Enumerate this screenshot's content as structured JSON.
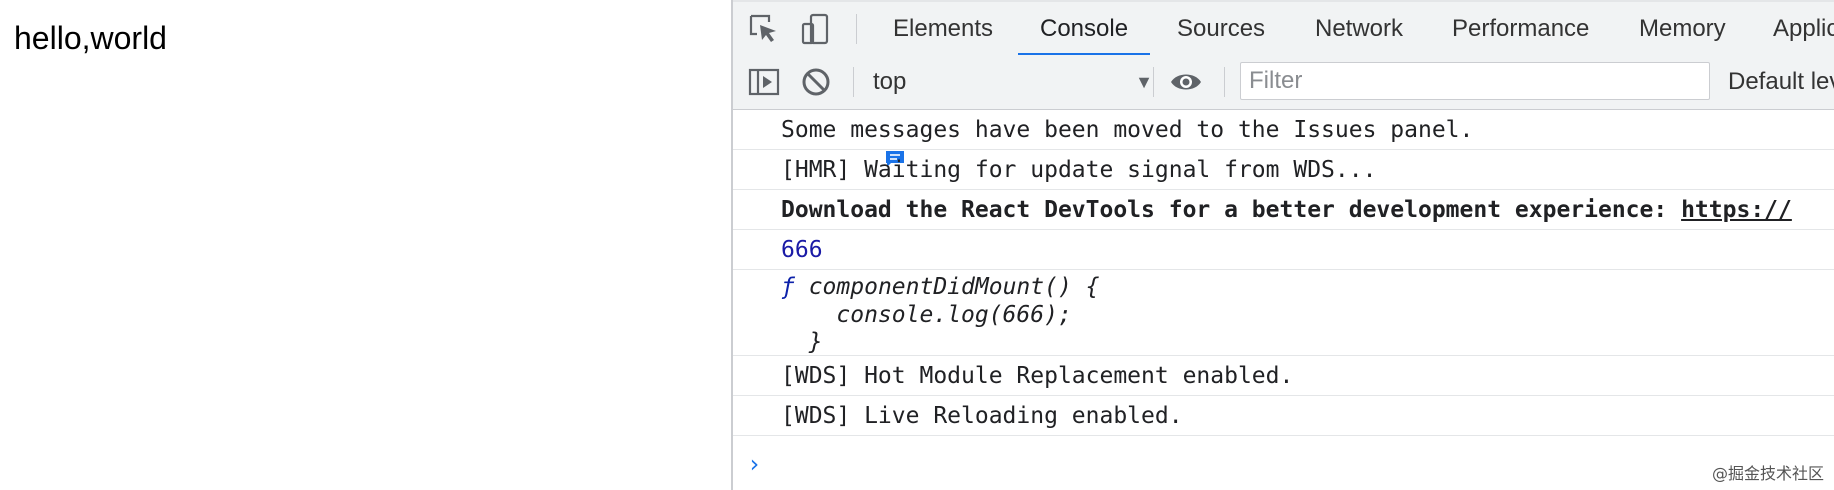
{
  "page": {
    "text": "hello,world"
  },
  "devtools": {
    "tabs": [
      {
        "label": "Elements"
      },
      {
        "label": "Console"
      },
      {
        "label": "Sources"
      },
      {
        "label": "Network"
      },
      {
        "label": "Performance"
      },
      {
        "label": "Memory"
      },
      {
        "label": "Applic"
      }
    ],
    "active_tab": "Console",
    "toolbar": {
      "context": "top",
      "filter_placeholder": "Filter",
      "levels": "Default lev"
    },
    "console": {
      "messages": [
        {
          "text": "Some messages have been moved to the Issues panel."
        },
        {
          "text": "[HMR] Waiting for update signal from WDS..."
        },
        {
          "text": "Download the React DevTools for a better development experience: ",
          "link": "https://"
        },
        {
          "text": "666"
        },
        {
          "fn_prefix": "ƒ",
          "fn_line1": " componentDidMount() {",
          "fn_line2": "    console.log(666);",
          "fn_line3": "  }"
        },
        {
          "text": "[WDS] Hot Module Replacement enabled."
        },
        {
          "text": "[WDS] Live Reloading enabled."
        }
      ],
      "prompt": "›"
    }
  },
  "watermark": "@掘金技术社区",
  "colors": {
    "accent": "#1a73e8",
    "number": "#1a1aa6",
    "toolbar_bg": "#f1f3f4"
  }
}
